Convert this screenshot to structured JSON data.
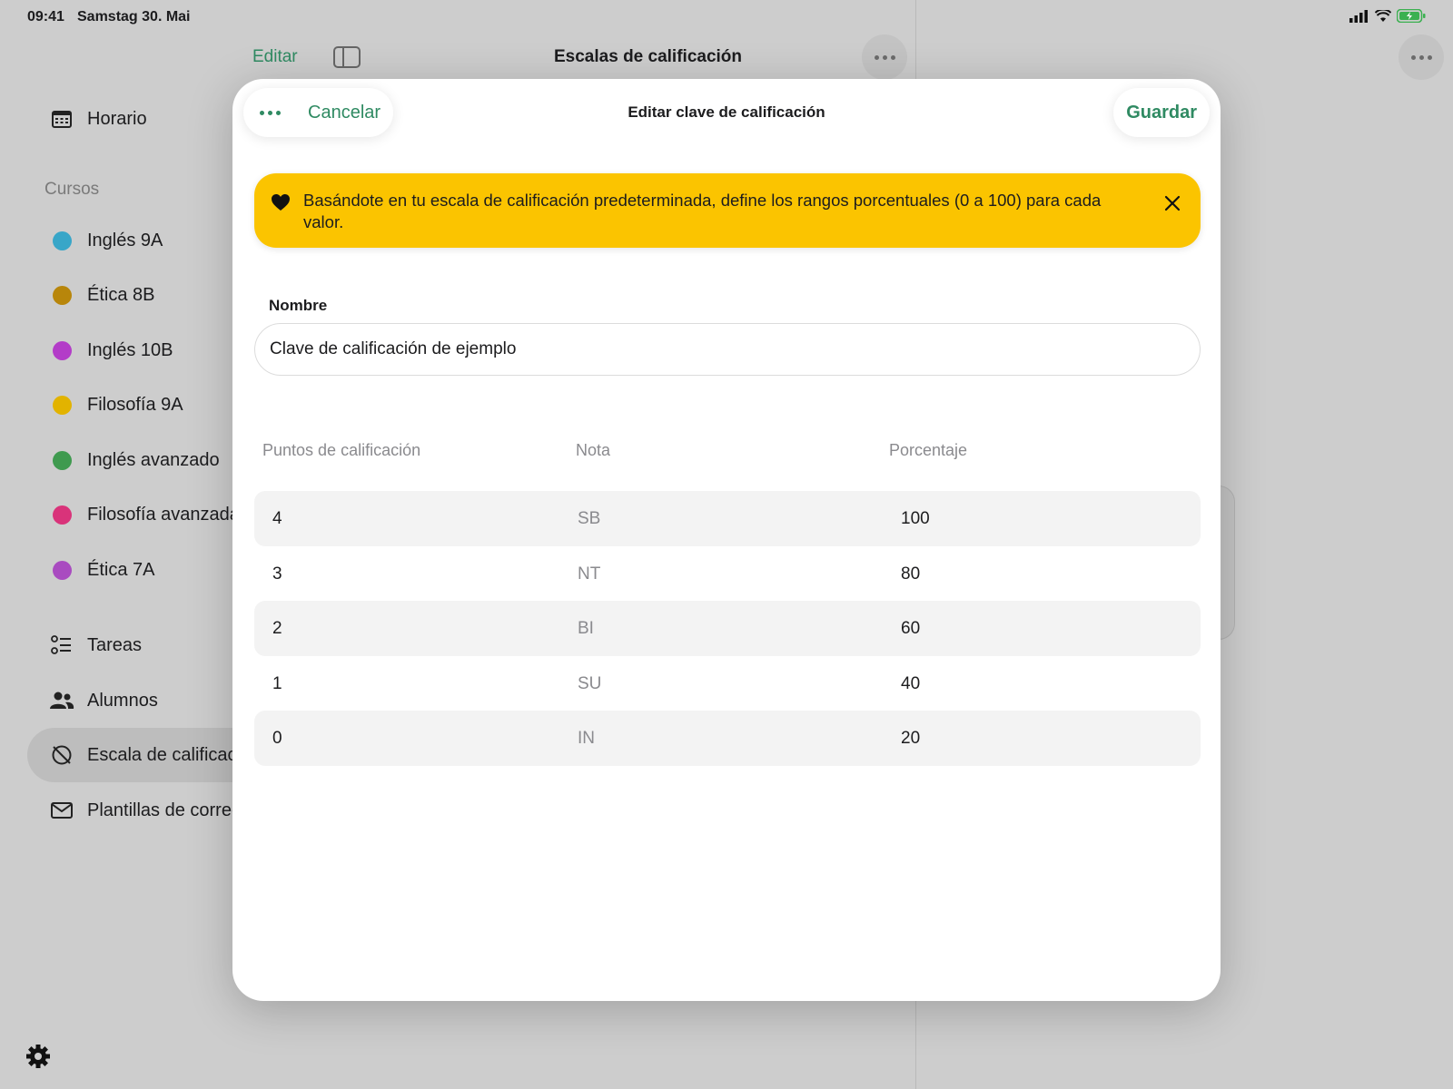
{
  "status": {
    "time": "09:41",
    "date": "Samstag 30. Mai"
  },
  "toolbar": {
    "edit_label": "Editar",
    "title": "Escalas de calificación"
  },
  "sidebar": {
    "top": {
      "label": "Horario"
    },
    "section_label": "Cursos",
    "courses": [
      {
        "label": "Inglés 9A",
        "color": "#38a6c8"
      },
      {
        "label": "Ética 8B",
        "color": "#b8860b"
      },
      {
        "label": "Inglés 10B",
        "color": "#b33cc8"
      },
      {
        "label": "Filosofía 9A",
        "color": "#e2b300"
      },
      {
        "label": "Inglés avanzado",
        "color": "#3f9a4f"
      },
      {
        "label": "Filosofía avanzada",
        "color": "#d9337a"
      },
      {
        "label": "Ética 7A",
        "color": "#a94bc0"
      }
    ],
    "items": [
      {
        "label": "Tareas",
        "icon": "tasks-icon"
      },
      {
        "label": "Alumnos",
        "icon": "people-icon"
      },
      {
        "label": "Escala de calificac",
        "icon": "grade-scale-icon",
        "active": true
      },
      {
        "label": "Plantillas de correo",
        "icon": "envelope-icon"
      }
    ]
  },
  "modal": {
    "title": "Editar clave de calificación",
    "cancel_label": "Cancelar",
    "save_label": "Guardar",
    "banner_text": "Basándote en tu escala de calificación predeterminada, define los rangos porcentuales (0 a 100) para cada valor.",
    "name_label": "Nombre",
    "name_value": "Clave de calificación de ejemplo",
    "columns": [
      "Puntos de calificación",
      "Nota",
      "Porcentaje"
    ],
    "rows": [
      {
        "points": "4",
        "nota": "SB",
        "pct": "100"
      },
      {
        "points": "3",
        "nota": "NT",
        "pct": "80"
      },
      {
        "points": "2",
        "nota": "BI",
        "pct": "60"
      },
      {
        "points": "1",
        "nota": "SU",
        "pct": "40"
      },
      {
        "points": "0",
        "nota": "IN",
        "pct": "20"
      }
    ]
  },
  "colors": {
    "accent": "#2f8a62",
    "banner": "#fbc400"
  }
}
